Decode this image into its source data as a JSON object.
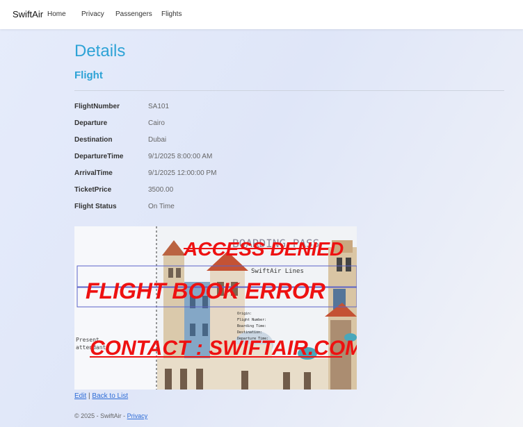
{
  "nav": {
    "brand": "SwiftAir",
    "links": [
      "Home",
      "Privacy",
      "Passengers",
      "Flights"
    ]
  },
  "page": {
    "title": "Details",
    "subtitle": "Flight"
  },
  "details": [
    {
      "label": "FlightNumber",
      "value": "SA101"
    },
    {
      "label": "Departure",
      "value": "Cairo"
    },
    {
      "label": "Destination",
      "value": "Dubai"
    },
    {
      "label": "DepartureTime",
      "value": "9/1/2025 8:00:00 AM"
    },
    {
      "label": "ArrivalTime",
      "value": "9/1/2025 12:00:00 PM"
    },
    {
      "label": "TicketPrice",
      "value": "3500.00"
    },
    {
      "label": "Flight Status",
      "value": "On Time"
    }
  ],
  "ticket_image": {
    "boarding_pass": "BOARDING PASS",
    "airline": "SwiftAir  Lines",
    "fields": [
      "Origin:",
      "Flight Number:",
      "Boarding Time:",
      "Destination:",
      "Departure Time:"
    ],
    "present_text_1": "Present",
    "present_text_2": "attendant",
    "overlay_access": "ACCESS DENIED",
    "overlay_error": "FLIGHT BOOK ERROR",
    "overlay_contact": "CONTACT : SWIFTAIR.COM",
    "overlay_color": "#ee1111"
  },
  "actions": {
    "edit": "Edit",
    "separator": "|",
    "back": "Back to List"
  },
  "footer": {
    "copyright": "© 2025 - SwiftAir - ",
    "privacy": "Privacy"
  }
}
